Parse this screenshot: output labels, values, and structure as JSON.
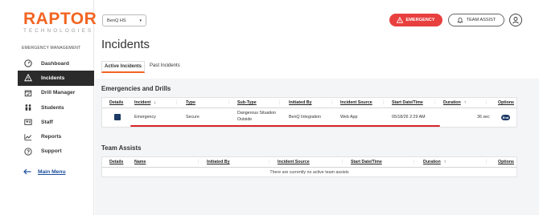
{
  "brand": {
    "name": "RAPTOR",
    "tagline": "TECHNOLOGIES",
    "color": "#f26522"
  },
  "sidebar": {
    "section_label": "EMERGENCY MANAGEMENT",
    "items": [
      {
        "label": "Dashboard",
        "icon": "gauge-icon"
      },
      {
        "label": "Incidents",
        "icon": "warning-icon",
        "active": true
      },
      {
        "label": "Drill Manager",
        "icon": "calendar-check-icon"
      },
      {
        "label": "Students",
        "icon": "students-icon"
      },
      {
        "label": "Staff",
        "icon": "staff-badge-icon"
      },
      {
        "label": "Reports",
        "icon": "line-chart-icon"
      },
      {
        "label": "Support",
        "icon": "help-circle-icon"
      }
    ],
    "main_menu": {
      "label": "Main Menu",
      "icon": "arrow-left-icon"
    }
  },
  "topbar": {
    "site_select": "BenQ HS",
    "emergency_label": "EMERGENCY",
    "team_assist_label": "TEAM ASSIST",
    "emergency_color": "#e8403f"
  },
  "page": {
    "title": "Incidents",
    "tabs": [
      {
        "label": "Active Incidents",
        "active": true
      },
      {
        "label": "Past Incidents",
        "active": false
      }
    ]
  },
  "emergencies": {
    "title": "Emergencies and Drills",
    "headers": {
      "details": "Details",
      "incident": "Incident",
      "type": "Type",
      "subtype": "Sub-Type",
      "initiated_by": "Initiated By",
      "incident_source": "Incident Source",
      "start": "Start Date/Time",
      "duration": "Duration",
      "options": "Options"
    },
    "incident_sort_arrow": "↓",
    "duration_sort_arrow": "↑",
    "row": {
      "incident": "Emergency",
      "type": "Secure",
      "subtype_line1": "Dangerous Situation",
      "subtype_line2": "Outside",
      "initiated_by": "BenQ Integration",
      "source": "Web App",
      "start": "05/18/26 2:29 AM",
      "duration": "36 sec",
      "option": "End"
    }
  },
  "team_assists": {
    "title": "Team Assists",
    "headers": {
      "details": "Details",
      "name": "Name",
      "initiated_by": "Initiated By",
      "incident_source": "Incident Source",
      "start": "Start Date/Time",
      "duration": "Duration",
      "options": "Options"
    },
    "duration_sort_arrow": "↑",
    "empty_message": "There are currently no active team assists"
  }
}
